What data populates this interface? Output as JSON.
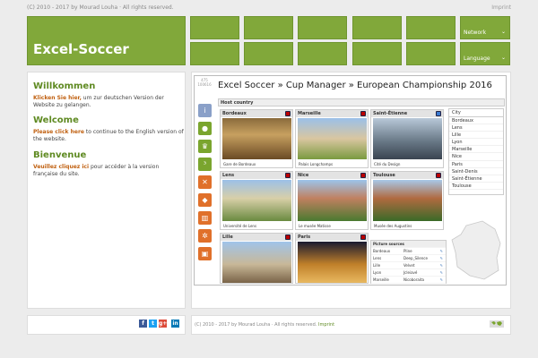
{
  "topbar": {
    "copyright": "(C) 2010 - 2017 by Mourad Louha · All rights reserved.",
    "imprint": "Imprint"
  },
  "brand": {
    "title": "Excel-Soccer"
  },
  "menu": {
    "network": "Network",
    "language": "Language"
  },
  "left": {
    "de_title": "Willkommen",
    "de_link": "Klicken Sie hier,",
    "de_text": " um zur deutschen Version der Website zu gelangen.",
    "en_title": "Welcome",
    "en_link": "Please click here",
    "en_text": " to continue to the English version of the website.",
    "fr_title": "Bienvenue",
    "fr_link": "Veuillez cliquez ici",
    "fr_text": " pour accéder à la version française du site."
  },
  "counter": {
    "line1": "475",
    "line2": "100616"
  },
  "breadcrumb": "Excel Soccer » Cup Manager » European Championship 2016",
  "host_header": "Host country",
  "cards": [
    {
      "name": "Bordeaux",
      "caption": "Gare de Bordeaux"
    },
    {
      "name": "Marseille",
      "caption": "Palais Longchamps"
    },
    {
      "name": "Saint-Étienne",
      "caption": "Cité du Design"
    },
    {
      "name": "Lens",
      "caption": "Université de Lens"
    },
    {
      "name": "Nice",
      "caption": "Le musée Matisse"
    },
    {
      "name": "Toulouse",
      "caption": "Musée des Augustins"
    },
    {
      "name": "Lille",
      "caption": ""
    },
    {
      "name": "Paris",
      "caption": ""
    }
  ],
  "city_list": {
    "header": "City",
    "items": [
      "Bordeaux",
      "Lens",
      "Lille",
      "Lyon",
      "Marseille",
      "Nice",
      "Paris",
      "Saint-Denis",
      "Saint-Étienne",
      "Toulouse"
    ]
  },
  "sources": {
    "header": "Picture sources",
    "rows": [
      {
        "city": "Bordeaux",
        "src": "Pline"
      },
      {
        "city": "Lens",
        "src": "Deep_Silence"
      },
      {
        "city": "Lille",
        "src": "Velvet"
      },
      {
        "city": "Lyon",
        "src": "Jcleiavé"
      },
      {
        "city": "Marseille",
        "src": "Nicoboraita"
      }
    ]
  },
  "footer": {
    "copyright": "(C) 2010 - 2017 by Mourad Louha · All rights reserved. ",
    "imprint": "Imprint"
  },
  "social": [
    "f",
    "t",
    "g+",
    "in"
  ],
  "colors": {
    "brand_green": "#81a83a",
    "link_orange": "#c06010"
  }
}
